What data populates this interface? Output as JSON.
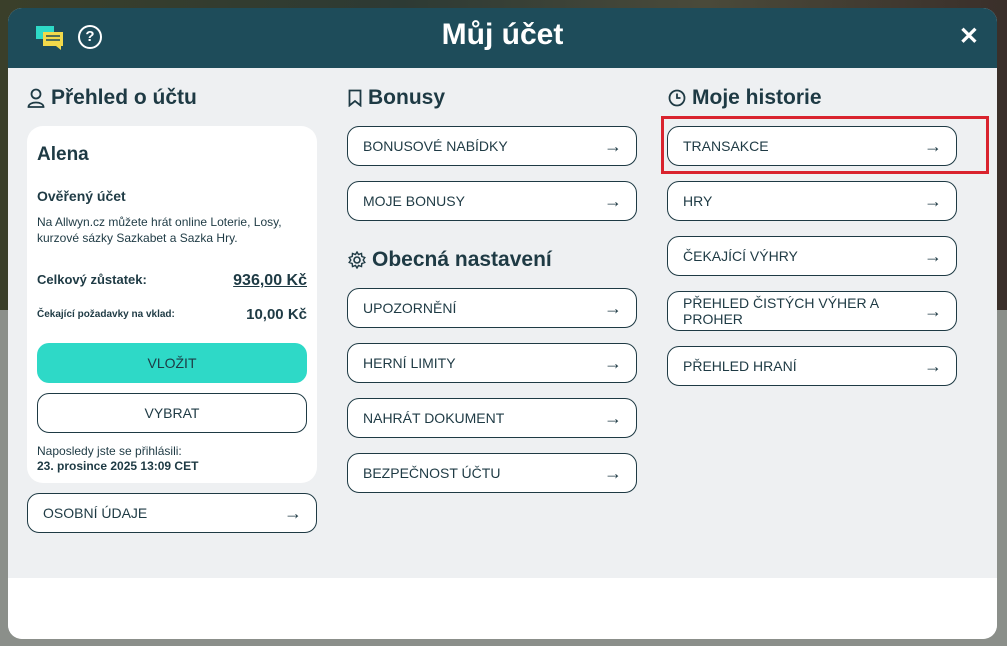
{
  "header": {
    "title": "Můj účet",
    "chat_icon": "chat-icon",
    "help_icon": "question-icon",
    "close_label": "✕"
  },
  "overview": {
    "heading": "Přehled o účtu",
    "icon": "user-icon",
    "name": "Alena",
    "verified": "Ověřený účet",
    "description": "Na Allwyn.cz můžete hrát online Loterie, Losy, kurzové sázky Sazkabet a Sazka Hry.",
    "balance_label": "Celkový zůstatek:",
    "balance_value": "936,00 Kč",
    "pending_label": "Čekající požadavky na vklad:",
    "pending_value": "10,00 Kč",
    "deposit_label": "VLOŽIT",
    "withdraw_label": "VYBRAT",
    "last_login_label": "Naposledy jste se přihlásili:",
    "last_login_value": "23. prosince 2025 13:09 CET",
    "personal_data_label": "OSOBNÍ ÚDAJE"
  },
  "bonuses": {
    "heading": "Bonusy",
    "icon": "bookmark-icon",
    "items": [
      "BONUSOVÉ NABÍDKY",
      "MOJE BONUSY"
    ]
  },
  "settings": {
    "heading": "Obecná nastavení",
    "icon": "gear-icon",
    "items": [
      "UPOZORNĚNÍ",
      "HERNÍ LIMITY",
      "NAHRÁT DOKUMENT",
      "BEZPEČNOST ÚČTU"
    ]
  },
  "history": {
    "heading": "Moje historie",
    "icon": "clock-icon",
    "items": [
      "TRANSAKCE",
      "HRY",
      "ČEKAJÍCÍ VÝHRY",
      "PŘEHLED ČISTÝCH VÝHER A PROHER",
      "PŘEHLED HRANÍ"
    ]
  },
  "arrow": "→",
  "colors": {
    "header": "#1e4c5a",
    "accent": "#2ed9c7",
    "text": "#1e3a44",
    "highlight": "#d9232e"
  }
}
